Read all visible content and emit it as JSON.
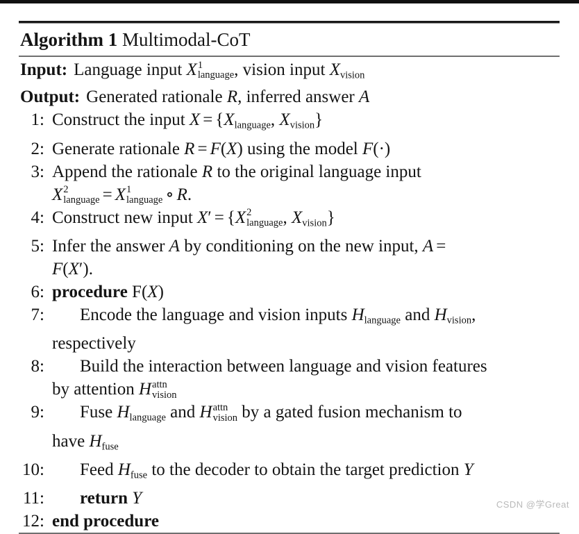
{
  "document": {
    "type": "algorithm-pseudocode",
    "watermark": "CSDN @学Great"
  },
  "algorithm": {
    "keyword": "Algorithm 1",
    "name": "Multimodal-CoT",
    "io": [
      {
        "label": "Input:",
        "text": "Language input X¹_language, vision input X_vision"
      },
      {
        "label": "Output:",
        "text": "Generated rationale R, inferred answer A"
      }
    ],
    "steps": [
      {
        "num": "1:",
        "text": "Construct the input X = {X_language, X_vision}"
      },
      {
        "num": "2:",
        "text": "Generate rationale R = F(X) using the model F(·)"
      },
      {
        "num": "3:",
        "text": "Append the rationale R to the original language input X²_language = X¹_language ∘ R."
      },
      {
        "num": "4:",
        "text": "Construct new input X′ = {X²_language, X_vision}"
      },
      {
        "num": "5:",
        "text": "Infer the answer A by conditioning on the new input, A = F(X′)."
      },
      {
        "num": "6:",
        "text": "procedure F(X)"
      },
      {
        "num": "7:",
        "text": "Encode the language and vision inputs H_language and H_vision, respectively"
      },
      {
        "num": "8:",
        "text": "Build the interaction between language and vision features by attention H^attn_vision"
      },
      {
        "num": "9:",
        "text": "Fuse H_language and H^attn_vision by a gated fusion mechanism to have H_fuse"
      },
      {
        "num": "10:",
        "text": "Feed H_fuse to the decoder to obtain the target prediction Y"
      },
      {
        "num": "11:",
        "text": "return Y"
      },
      {
        "num": "12:",
        "text": "end procedure"
      }
    ],
    "keywords_bold": [
      "procedure",
      "return",
      "end procedure"
    ],
    "symbols": {
      "set_open": "{",
      "set_close": "}",
      "equals": "=",
      "compose": "∘",
      "prime": "′",
      "cdot": "·"
    }
  }
}
